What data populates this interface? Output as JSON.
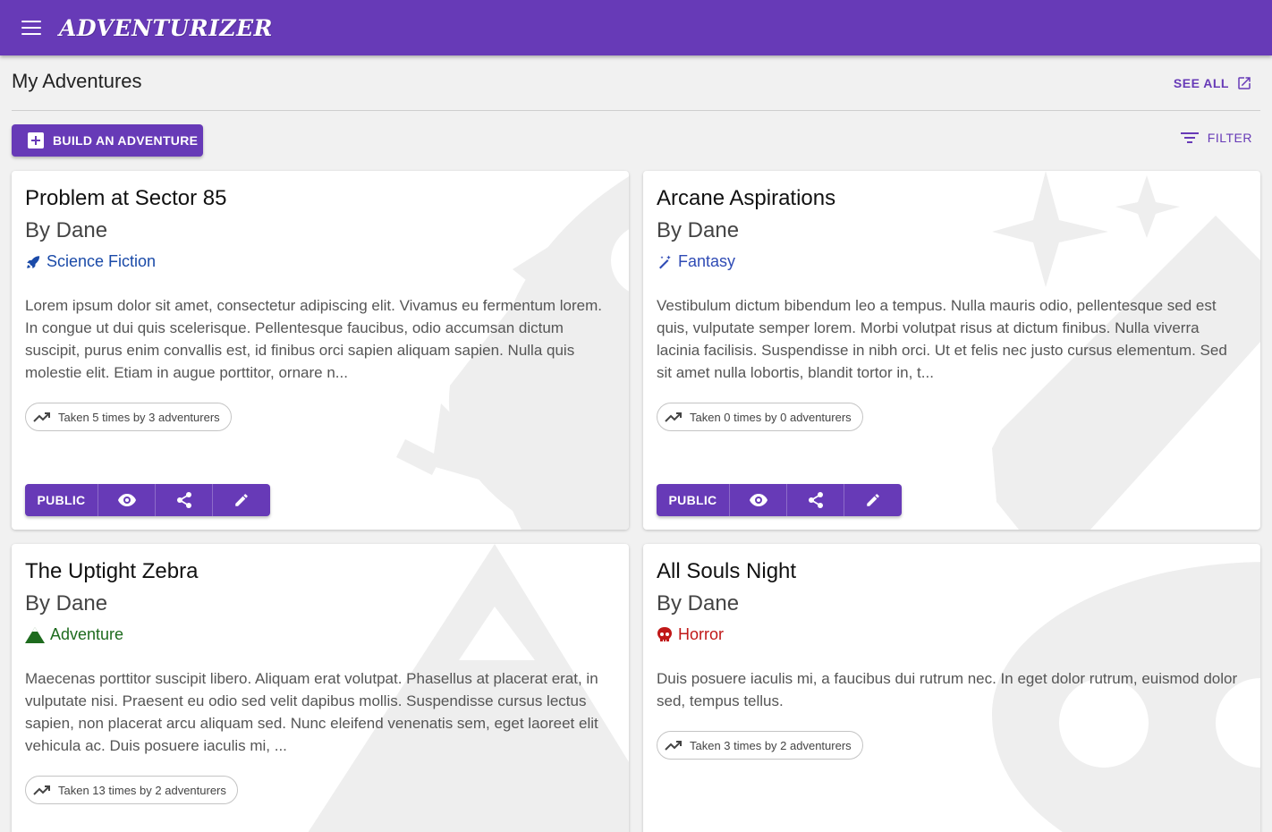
{
  "app": {
    "name": "ADVENTURIZER"
  },
  "page": {
    "title": "My Adventures",
    "see_all": "SEE ALL",
    "build_label": "BUILD AN ADVENTURE",
    "filter_label": "FILTER"
  },
  "colors": {
    "primary": "#673ab7",
    "scifi": "#1a4aa8",
    "fantasy": "#2f4bb5",
    "adventure": "#1e6b1e",
    "horror": "#c01818"
  },
  "cards": [
    {
      "title": "Problem at Sector 85",
      "author": "By Dane",
      "genre": "Science Fiction",
      "genre_icon": "rocket-icon",
      "description": "Lorem ipsum dolor sit amet, consectetur adipiscing elit. Vivamus eu fermentum lorem. In congue ut dui quis scelerisque. Pellentesque faucibus, odio accumsan dictum suscipit, purus enim convallis est, id finibus orci sapien aliquam sapien. Nulla quis molestie elit. Etiam in augue porttitor, ornare n...",
      "stats": "Taken 5 times by 3 adventurers",
      "visibility": "PUBLIC"
    },
    {
      "title": "Arcane Aspirations",
      "author": "By Dane",
      "genre": "Fantasy",
      "genre_icon": "magic-wand-icon",
      "description": "Vestibulum dictum bibendum leo a tempus. Nulla mauris odio, pellentesque sed est quis, vulputate semper lorem. Morbi volutpat risus at dictum finibus. Nulla viverra lacinia facilisis. Suspendisse in nibh orci. Ut et felis nec justo cursus elementum. Sed sit amet nulla lobortis, blandit tortor in, t...",
      "stats": "Taken 0 times by 0 adventurers",
      "visibility": "PUBLIC"
    },
    {
      "title": "The Uptight Zebra",
      "author": "By Dane",
      "genre": "Adventure",
      "genre_icon": "mountain-icon",
      "description": "Maecenas porttitor suscipit libero. Aliquam erat volutpat. Phasellus at placerat erat, in vulputate nisi. Praesent eu odio sed velit dapibus mollis. Suspendisse cursus lectus sapien, non placerat arcu aliquam sed. Nunc eleifend venenatis sem, eget laoreet elit vehicula ac. Duis posuere iaculis mi, ...",
      "stats": "Taken 13 times by 2 adventurers"
    },
    {
      "title": "All Souls Night",
      "author": "By Dane",
      "genre": "Horror",
      "genre_icon": "skull-icon",
      "description": "Duis posuere iaculis mi, a faucibus dui rutrum nec. In eget dolor rutrum, euismod dolor sed, tempus tellus.",
      "stats": "Taken 3 times by 2 adventurers"
    }
  ]
}
